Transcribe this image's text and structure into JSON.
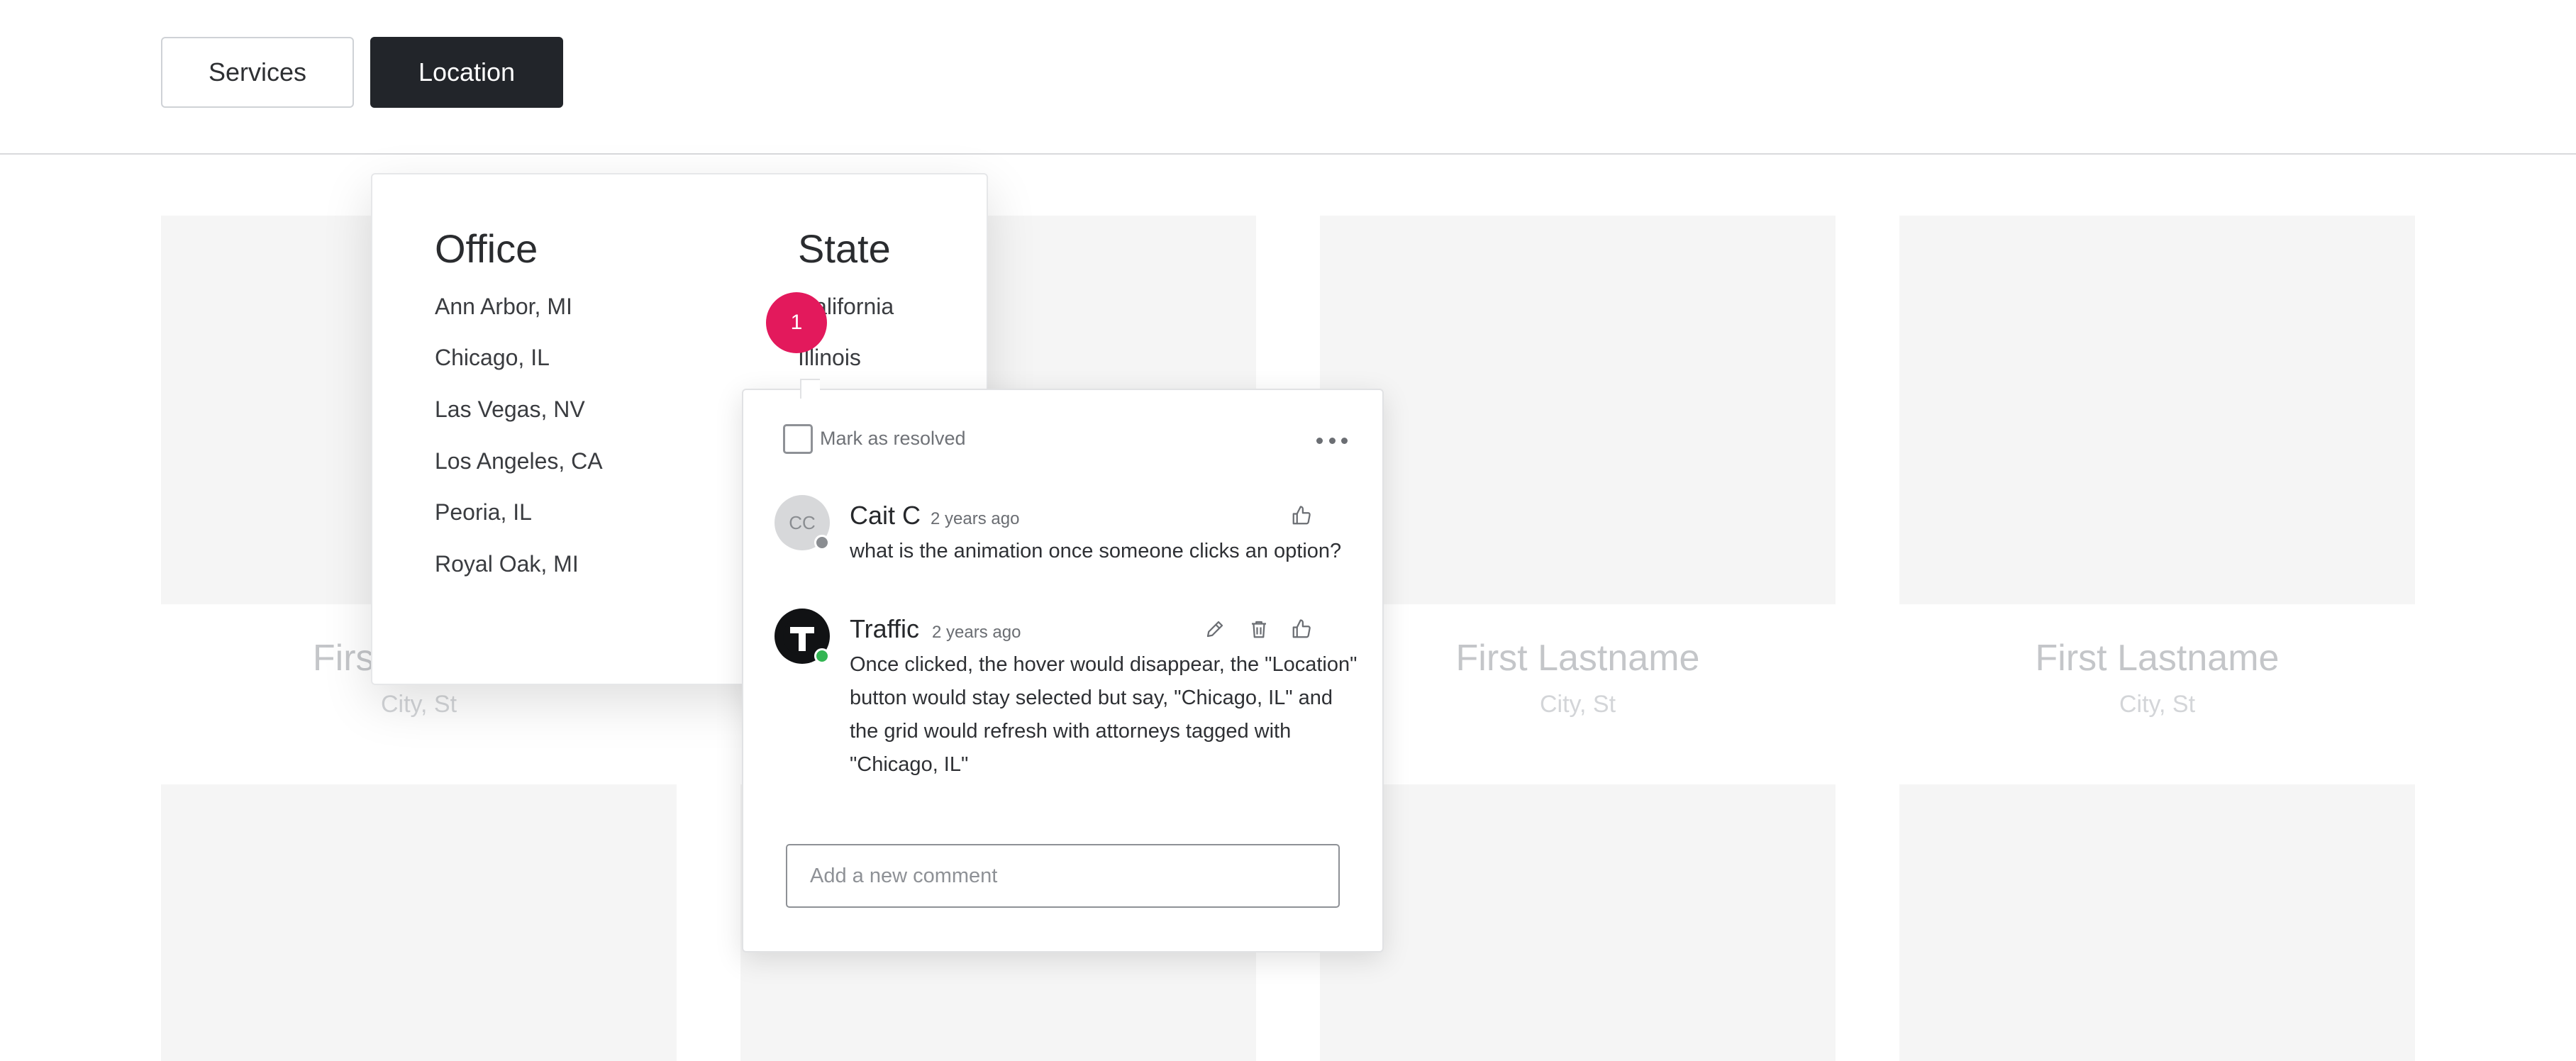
{
  "filters": {
    "services_label": "Services",
    "location_label": "Location"
  },
  "cards": [
    {
      "name": "First",
      "city": "City, St"
    },
    {
      "name": "First Lastname",
      "city": "City, St"
    },
    {
      "name": "First Lastname",
      "city": "City, St"
    }
  ],
  "location_dropdown": {
    "office_heading": "Office",
    "state_heading": "State",
    "offices": [
      "Ann Arbor, MI",
      "Chicago, IL",
      "Las Vegas, NV",
      "Los Angeles, CA",
      "Peoria, IL",
      "Royal Oak, MI"
    ],
    "states": [
      "California",
      "Illinois"
    ]
  },
  "comment_pin": {
    "number": "1",
    "color": "#e3195c"
  },
  "comment_thread": {
    "resolve_label": "Mark as resolved",
    "comments": [
      {
        "avatar_initials": "CC",
        "author": "Cait C",
        "time": "2 years ago",
        "body": "what is the animation once someone clicks an option?"
      },
      {
        "avatar_initials": "",
        "author": "Traffic",
        "time": "2 years ago",
        "body": "Once clicked, the hover would disappear, the \"Location\" button would stay selected but say, \"Chicago, IL\" and the grid would refresh with attorneys tagged with \"Chicago, IL\""
      }
    ],
    "new_comment_placeholder": "Add a new comment"
  },
  "icons": {
    "more": "more-horizontal-icon",
    "like": "thumbs-up-icon",
    "edit": "pencil-icon",
    "delete": "trash-icon"
  }
}
